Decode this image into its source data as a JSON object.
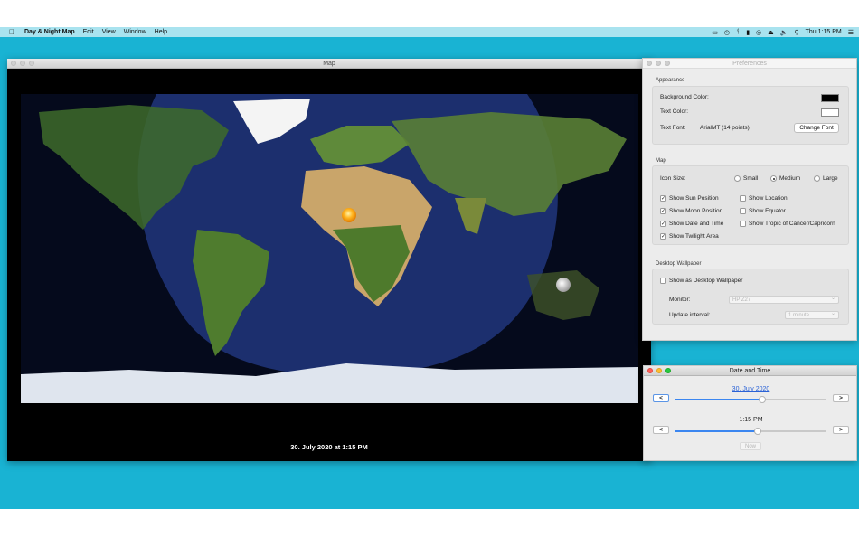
{
  "menubar": {
    "apple_icon": "apple-logo-icon",
    "app_name": "Day & Night Map",
    "items": [
      "Edit",
      "View",
      "Window",
      "Help"
    ],
    "status_icons": [
      "airplay-icon",
      "time-machine-icon",
      "bluetooth-icon",
      "battery-icon",
      "wifi-icon",
      "eject-icon",
      "volume-icon",
      "search-icon"
    ],
    "clock": "Thu 1:15 PM",
    "list_icon": "notification-center-icon"
  },
  "colors": {
    "desktop": "#19b3d3",
    "menubar": "#a9e3ef",
    "ocean": "#1c2f6e",
    "night": "#000000",
    "link": "#2a62d6",
    "slider_fill": "#3b86f0"
  },
  "map_window": {
    "title": "Map",
    "caption": "30. July 2020 at 1:15 PM",
    "sun_icon": "sun-icon",
    "moon_icon": "moon-icon"
  },
  "preferences": {
    "title": "Preferences",
    "appearance": {
      "heading": "Appearance",
      "background_color_label": "Background Color:",
      "background_color_value": "#000000",
      "text_color_label": "Text Color:",
      "text_color_value": "#ffffff",
      "text_font_label": "Text Font:",
      "text_font_value": "ArialMT (14 points)",
      "change_font_label": "Change Font"
    },
    "map": {
      "heading": "Map",
      "icon_size_label": "Icon Size:",
      "sizes": [
        {
          "label": "Small",
          "selected": false
        },
        {
          "label": "Medium",
          "selected": true
        },
        {
          "label": "Large",
          "selected": false
        }
      ],
      "left_options": [
        {
          "label": "Show Sun Position",
          "checked": true
        },
        {
          "label": "Show Moon Position",
          "checked": true
        },
        {
          "label": "Show Date and Time",
          "checked": true
        },
        {
          "label": "Show Twilight Area",
          "checked": true
        }
      ],
      "right_options": [
        {
          "label": "Show Location",
          "checked": false
        },
        {
          "label": "Show Equator",
          "checked": false
        },
        {
          "label": "Show Tropic of Cancer/Capricorn",
          "checked": false
        }
      ]
    },
    "wallpaper": {
      "heading": "Desktop Wallpaper",
      "show_label": "Show as Desktop Wallpaper",
      "show_checked": false,
      "monitor_label": "Monitor:",
      "monitor_value": "HP Z27",
      "interval_label": "Update interval:",
      "interval_value": "1 minute"
    }
  },
  "date_time": {
    "title": "Date and Time",
    "date": "30. July 2020",
    "time": "1:15 PM",
    "prev_label": "<",
    "next_label": ">",
    "date_slider": 0.58,
    "time_slider": 0.55,
    "now_label": "Now"
  }
}
